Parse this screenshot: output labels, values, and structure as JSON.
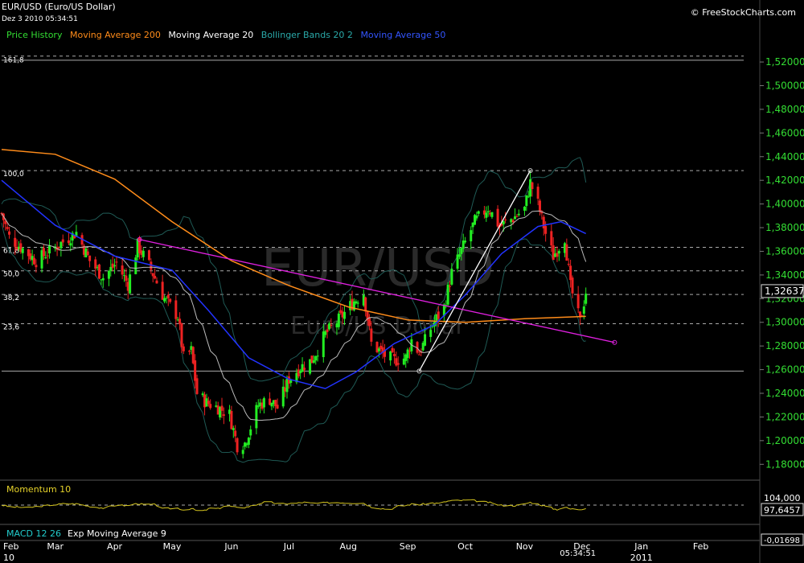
{
  "header": {
    "title": "EUR/USD (Euro/US Dollar)",
    "datetime": "Dez 3 2010 05:34:51",
    "copyright": "© FreeStockCharts.com"
  },
  "legend": [
    {
      "label": "Price History",
      "color": "#33dd33"
    },
    {
      "label": "Moving Average 200",
      "color": "#ff8c1a"
    },
    {
      "label": "Moving Average 20",
      "color": "#ffffff"
    },
    {
      "label": "Bollinger Bands 20 2",
      "color": "#2aa9a9"
    },
    {
      "label": "Moving Average 50",
      "color": "#2244ff"
    }
  ],
  "watermark": {
    "symbol": "EUR/USD",
    "name": "Euro/US Dollar"
  },
  "chart_data": [
    {
      "type": "candlestick",
      "y_ticks": [
        "1,52000",
        "1,50000",
        "1,48000",
        "1,46000",
        "1,44000",
        "1,42000",
        "1,40000",
        "1,38000",
        "1,36000",
        "1,34000",
        "1,32000",
        "1,30000",
        "1,28000",
        "1,26000",
        "1,24000",
        "1,22000",
        "1,20000",
        "1,18000"
      ],
      "ylim": [
        1.17,
        1.535
      ],
      "current_value_label": "1,32637",
      "current_value": 1.32637,
      "x_ticks": [
        {
          "label": "Feb",
          "sub": "10"
        },
        {
          "label": "Mar"
        },
        {
          "label": "Apr"
        },
        {
          "label": "May"
        },
        {
          "label": "Jun"
        },
        {
          "label": "Jul"
        },
        {
          "label": "Aug"
        },
        {
          "label": "Sep"
        },
        {
          "label": "Oct"
        },
        {
          "label": "Nov"
        },
        {
          "label": "Dec"
        },
        {
          "label": "Jan",
          "sub": "2011"
        },
        {
          "label": "Feb"
        }
      ],
      "x_cursor_label": "05:34:51",
      "fibonacci": {
        "low": 1.2588,
        "high": 1.4282,
        "levels": [
          {
            "label": "161,8",
            "value": 1.525
          },
          {
            "label": "100,0",
            "value": 1.4282
          },
          {
            "label": "61,8",
            "value": 1.3634
          },
          {
            "label": "50,0",
            "value": 1.3435
          },
          {
            "label": "38,2",
            "value": 1.3235
          },
          {
            "label": "23,6",
            "value": 1.2988
          }
        ]
      },
      "close_path": [
        [
          "2010-02-01",
          1.392
        ],
        [
          "2010-02-05",
          1.372
        ],
        [
          "2010-02-12",
          1.362
        ],
        [
          "2010-02-19",
          1.352
        ],
        [
          "2010-02-26",
          1.36
        ],
        [
          "2010-03-05",
          1.368
        ],
        [
          "2010-03-12",
          1.376
        ],
        [
          "2010-03-19",
          1.352
        ],
        [
          "2010-03-26",
          1.338
        ],
        [
          "2010-04-02",
          1.35
        ],
        [
          "2010-04-08",
          1.332
        ],
        [
          "2010-04-13",
          1.365
        ],
        [
          "2010-04-19",
          1.348
        ],
        [
          "2010-04-27",
          1.32
        ],
        [
          "2010-05-04",
          1.305
        ],
        [
          "2010-05-07",
          1.27
        ],
        [
          "2010-05-11",
          1.276
        ],
        [
          "2010-05-14",
          1.24
        ],
        [
          "2010-05-19",
          1.232
        ],
        [
          "2010-05-25",
          1.228
        ],
        [
          "2010-05-31",
          1.222
        ],
        [
          "2010-06-04",
          1.196
        ],
        [
          "2010-06-08",
          1.198
        ],
        [
          "2010-06-15",
          1.23
        ],
        [
          "2010-06-21",
          1.235
        ],
        [
          "2010-06-25",
          1.228
        ],
        [
          "2010-07-01",
          1.252
        ],
        [
          "2010-07-07",
          1.262
        ],
        [
          "2010-07-13",
          1.268
        ],
        [
          "2010-07-20",
          1.29
        ],
        [
          "2010-07-27",
          1.302
        ],
        [
          "2010-08-04",
          1.318
        ],
        [
          "2010-08-09",
          1.325
        ],
        [
          "2010-08-13",
          1.282
        ],
        [
          "2010-08-20",
          1.272
        ],
        [
          "2010-08-25",
          1.268
        ],
        [
          "2010-08-31",
          1.27
        ],
        [
          "2010-09-03",
          1.285
        ],
        [
          "2010-09-07",
          1.274
        ],
        [
          "2010-09-14",
          1.298
        ],
        [
          "2010-09-20",
          1.313
        ],
        [
          "2010-09-24",
          1.342
        ],
        [
          "2010-09-30",
          1.364
        ],
        [
          "2010-10-06",
          1.385
        ],
        [
          "2010-10-13",
          1.397
        ],
        [
          "2010-10-19",
          1.381
        ],
        [
          "2010-10-26",
          1.388
        ],
        [
          "2010-11-01",
          1.396
        ],
        [
          "2010-11-04",
          1.418
        ],
        [
          "2010-11-08",
          1.4
        ],
        [
          "2010-11-12",
          1.375
        ],
        [
          "2010-11-16",
          1.356
        ],
        [
          "2010-11-22",
          1.372
        ],
        [
          "2010-11-25",
          1.33
        ],
        [
          "2010-11-30",
          1.3
        ],
        [
          "2010-12-03",
          1.326
        ]
      ],
      "ma200_path": [
        [
          "2010-02-01",
          1.446
        ],
        [
          "2010-03-01",
          1.442
        ],
        [
          "2010-04-01",
          1.421
        ],
        [
          "2010-05-01",
          1.385
        ],
        [
          "2010-06-01",
          1.352
        ],
        [
          "2010-07-01",
          1.331
        ],
        [
          "2010-08-01",
          1.313
        ],
        [
          "2010-09-01",
          1.302
        ],
        [
          "2010-10-01",
          1.3
        ],
        [
          "2010-11-01",
          1.303
        ],
        [
          "2010-12-03",
          1.305
        ]
      ],
      "ma50_path": [
        [
          "2010-02-01",
          1.42
        ],
        [
          "2010-03-01",
          1.382
        ],
        [
          "2010-04-01",
          1.356
        ],
        [
          "2010-05-01",
          1.344
        ],
        [
          "2010-05-20",
          1.31
        ],
        [
          "2010-06-10",
          1.27
        ],
        [
          "2010-07-01",
          1.252
        ],
        [
          "2010-07-20",
          1.244
        ],
        [
          "2010-08-05",
          1.258
        ],
        [
          "2010-08-25",
          1.282
        ],
        [
          "2010-09-15",
          1.298
        ],
        [
          "2010-10-01",
          1.323
        ],
        [
          "2010-10-20",
          1.358
        ],
        [
          "2010-11-08",
          1.381
        ],
        [
          "2010-11-20",
          1.385
        ],
        [
          "2010-12-03",
          1.375
        ]
      ],
      "trendlines": [
        {
          "name": "descending",
          "color": "#e020e0",
          "points": [
            [
              "2010-04-14",
              1.37
            ],
            [
              "2010-12-18",
              1.283
            ]
          ]
        },
        {
          "name": "rally",
          "color": "#ffffff",
          "points": [
            [
              "2010-09-07",
              1.2588
            ],
            [
              "2010-11-04",
              1.4282
            ]
          ]
        }
      ],
      "hline": {
        "value": 1.2588
      }
    },
    {
      "type": "line",
      "title": "Momentum 10",
      "ticks": [
        "104,000"
      ],
      "current_value_label": "97,6457",
      "reference": 100
    },
    {
      "type": "line",
      "title": "MACD 12 26",
      "subtitle": "Exp Moving Average 9",
      "ticks": [
        "-0,01698"
      ]
    }
  ]
}
